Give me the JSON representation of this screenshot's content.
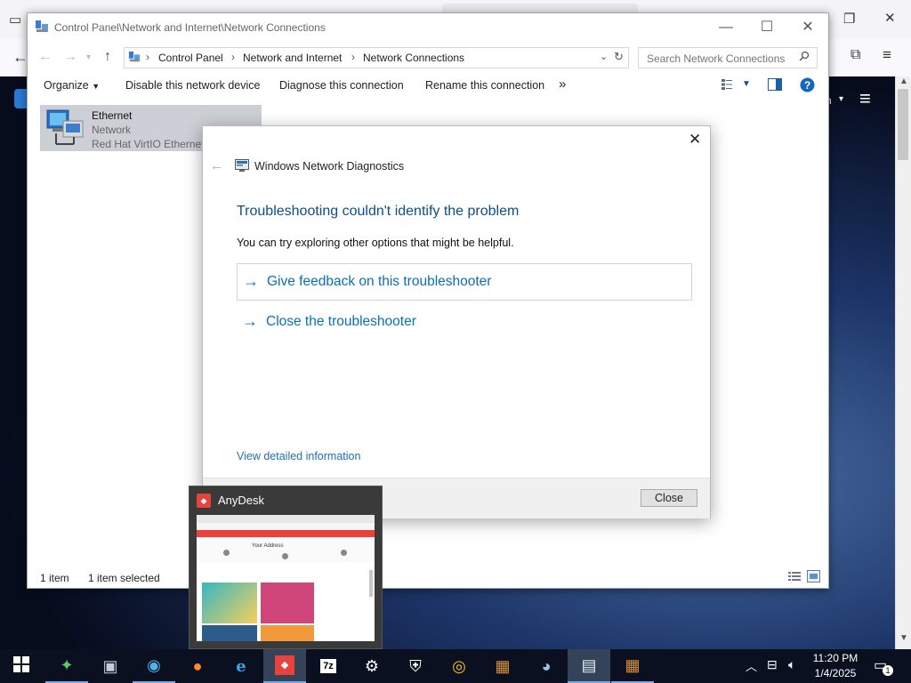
{
  "explorer": {
    "title": "Control Panel\\Network and Internet\\Network Connections",
    "breadcrumbs": [
      "Control Panel",
      "Network and Internet",
      "Network Connections"
    ],
    "search_placeholder": "Search Network Connections",
    "commands": {
      "organize": "Organize",
      "disable": "Disable this network device",
      "diagnose": "Diagnose this connection",
      "rename": "Rename this connection",
      "more": "»"
    },
    "item": {
      "name": "Ethernet",
      "status": "Network",
      "adapter": "Red Hat VirtIO Ethernet"
    },
    "status": {
      "count": "1 item",
      "selected": "1 item selected"
    }
  },
  "dialog": {
    "app_title": "Windows Network Diagnostics",
    "heading": "Troubleshooting couldn't identify the problem",
    "subtext": "You can try exploring other options that might be helpful.",
    "options": [
      "Give feedback on this troubleshooter",
      "Close the troubleshooter"
    ],
    "details_link": "View detailed information",
    "close_button": "Close"
  },
  "anydesk_preview": {
    "title": "AnyDesk",
    "thumb_heading": "Your Address"
  },
  "taskbar": {
    "time": "11:20 PM",
    "date": "1/4/2025",
    "notification_count": "1"
  },
  "browser_bg": {
    "menu_text": "h"
  },
  "colors": {
    "accent_link": "#0a6fb4",
    "heading_blue": "#0a4e8c",
    "taskbar": "#0a1020",
    "anydesk_red": "#e8423b"
  },
  "icons": [
    "network-connections-icon",
    "ethernet-adapter-icon",
    "network-diagnostics-icon",
    "anydesk-icon",
    "windows-start-icon",
    "help-icon",
    "refresh-icon",
    "search-icon"
  ]
}
